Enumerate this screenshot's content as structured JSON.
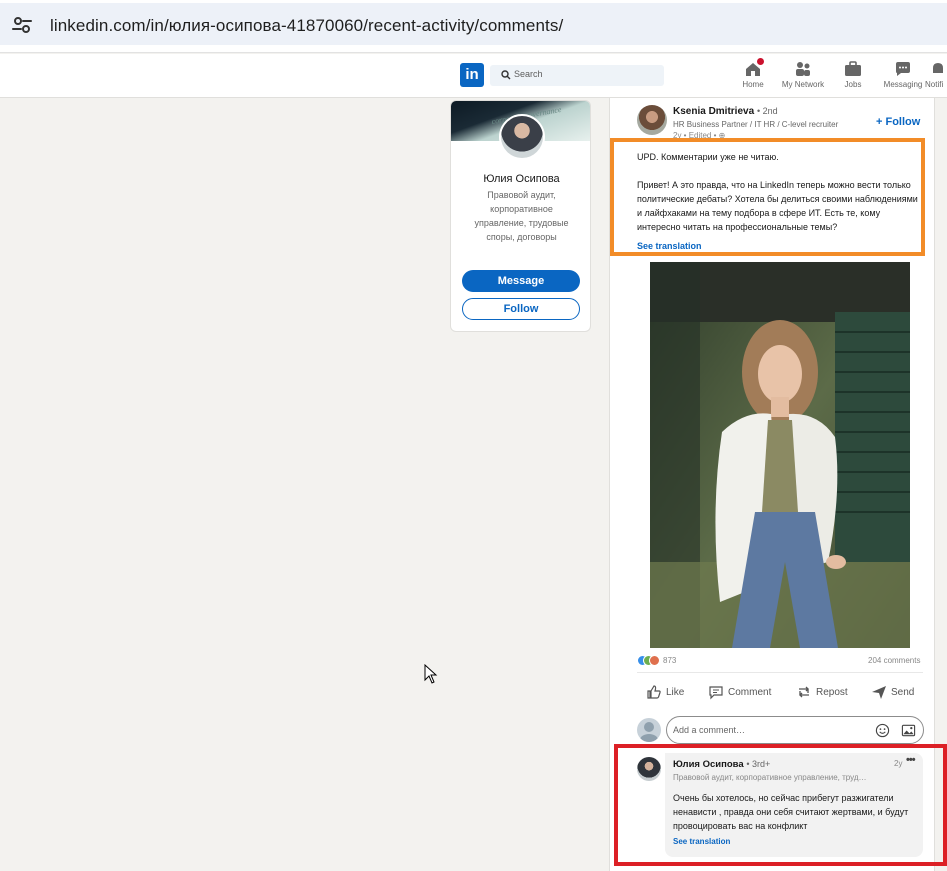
{
  "browser": {
    "url": "linkedin.com/in/юлия-осипова-41870060/recent-activity/comments/"
  },
  "nav": {
    "logo": "in",
    "search_placeholder": "Search",
    "items": [
      {
        "label": "Home",
        "icon": "home-icon"
      },
      {
        "label": "My Network",
        "icon": "network-icon"
      },
      {
        "label": "Jobs",
        "icon": "briefcase-icon"
      },
      {
        "label": "Messaging",
        "icon": "messaging-icon"
      },
      {
        "label": "Notifi",
        "icon": "bell-icon"
      }
    ]
  },
  "profile": {
    "cover_text": "corporate governance",
    "name": "Юлия Осипова",
    "headline": "Правовой аудит, корпоративное управление, трудовые споры, договоры",
    "message_label": "Message",
    "follow_label": "Follow"
  },
  "post": {
    "author": {
      "name": "Ksenia Dmitrieva",
      "degree": "• 2nd",
      "headline": "HR Business Partner / IT HR / C-level recruiter",
      "meta": "2y • Edited • ⊕"
    },
    "follow_label": "+ Follow",
    "text_line1": "UPD. Комментарии уже не читаю.",
    "text_para2": "Привет! А это правда, что на LinkedIn теперь можно вести только политические дебаты? Хотела бы делиться своими наблюдениями и лайфхаками на тему подбора в сфере ИТ. Есть те, кому интересно читать на профессиональные темы?",
    "see_translation": "See translation",
    "reactions_count": "873",
    "comments_count": "204 comments",
    "actions": {
      "like": "Like",
      "comment": "Comment",
      "repost": "Repost",
      "send": "Send"
    },
    "comment_placeholder": "Add a comment…"
  },
  "comment": {
    "name": "Юлия Осипова",
    "degree": "• 3rd+",
    "time": "2y",
    "dots": "•••",
    "headline": "Правовой аудит, корпоративное управление, труд…",
    "body": "Очень бы хотелось, но сейчас прибегут разжигатели ненависти , правда они себя считают жертвами, и будут провоцировать вас на конфликт",
    "see_translation": "See translation"
  },
  "colors": {
    "linkedin_blue": "#0a66c2",
    "highlight_orange": "#f28c28",
    "highlight_red": "#dc2026",
    "page_bg": "#f3f2ef"
  }
}
